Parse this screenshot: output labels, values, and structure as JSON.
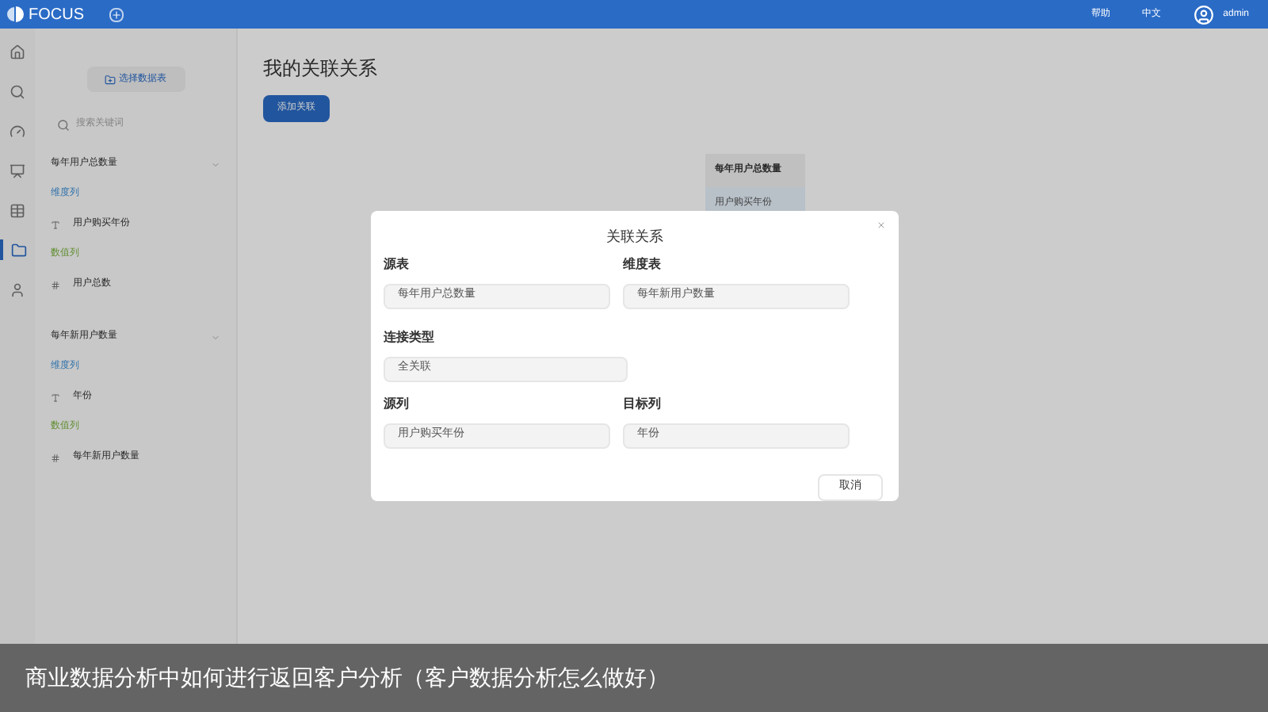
{
  "topbar": {
    "logo": "FOCUS",
    "links": [
      "帮助",
      "中文"
    ],
    "user": "admin"
  },
  "rail": [
    {
      "kind": "home",
      "selected": false
    },
    {
      "kind": "search",
      "selected": false
    },
    {
      "kind": "gauge",
      "selected": false
    },
    {
      "kind": "board",
      "selected": false
    },
    {
      "kind": "table",
      "selected": false
    },
    {
      "kind": "folder",
      "selected": true
    },
    {
      "kind": "user",
      "selected": false
    }
  ],
  "sidebar": {
    "select_button": "选择数据表",
    "search": {
      "placeholder": "搜索关键词"
    },
    "tables": [
      {
        "name": "每年用户总数量",
        "groups": [
          {
            "kind": "dimension",
            "label": "维度列",
            "items": [
              "用户购买年份"
            ]
          },
          {
            "kind": "measure",
            "label": "数值列",
            "items": [
              "用户总数"
            ]
          }
        ]
      },
      {
        "name": "每年新用户数量",
        "groups": [
          {
            "kind": "dimension",
            "label": "维度列",
            "items": [
              "年份"
            ]
          },
          {
            "kind": "measure",
            "label": "数值列",
            "items": [
              "每年新用户数量"
            ]
          }
        ]
      }
    ]
  },
  "main": {
    "title": "我的关联关系",
    "add_button": "添加关联",
    "card": {
      "title": "每年用户总数量",
      "row": "用户购买年份"
    }
  },
  "dialog": {
    "title": "关联关系",
    "fields": [
      {
        "label": "源表",
        "value": "每年用户总数量"
      },
      {
        "label": "维度表",
        "value": "每年新用户数量"
      },
      {
        "label": "连接类型",
        "value": "全关联"
      },
      {
        "label": "源列",
        "value": "用户购买年份"
      },
      {
        "label": "目标列",
        "value": "年份"
      }
    ],
    "cancel": "取消"
  },
  "caption": "商业数据分析中如何进行返回客户分析（客户数据分析怎么做好）"
}
